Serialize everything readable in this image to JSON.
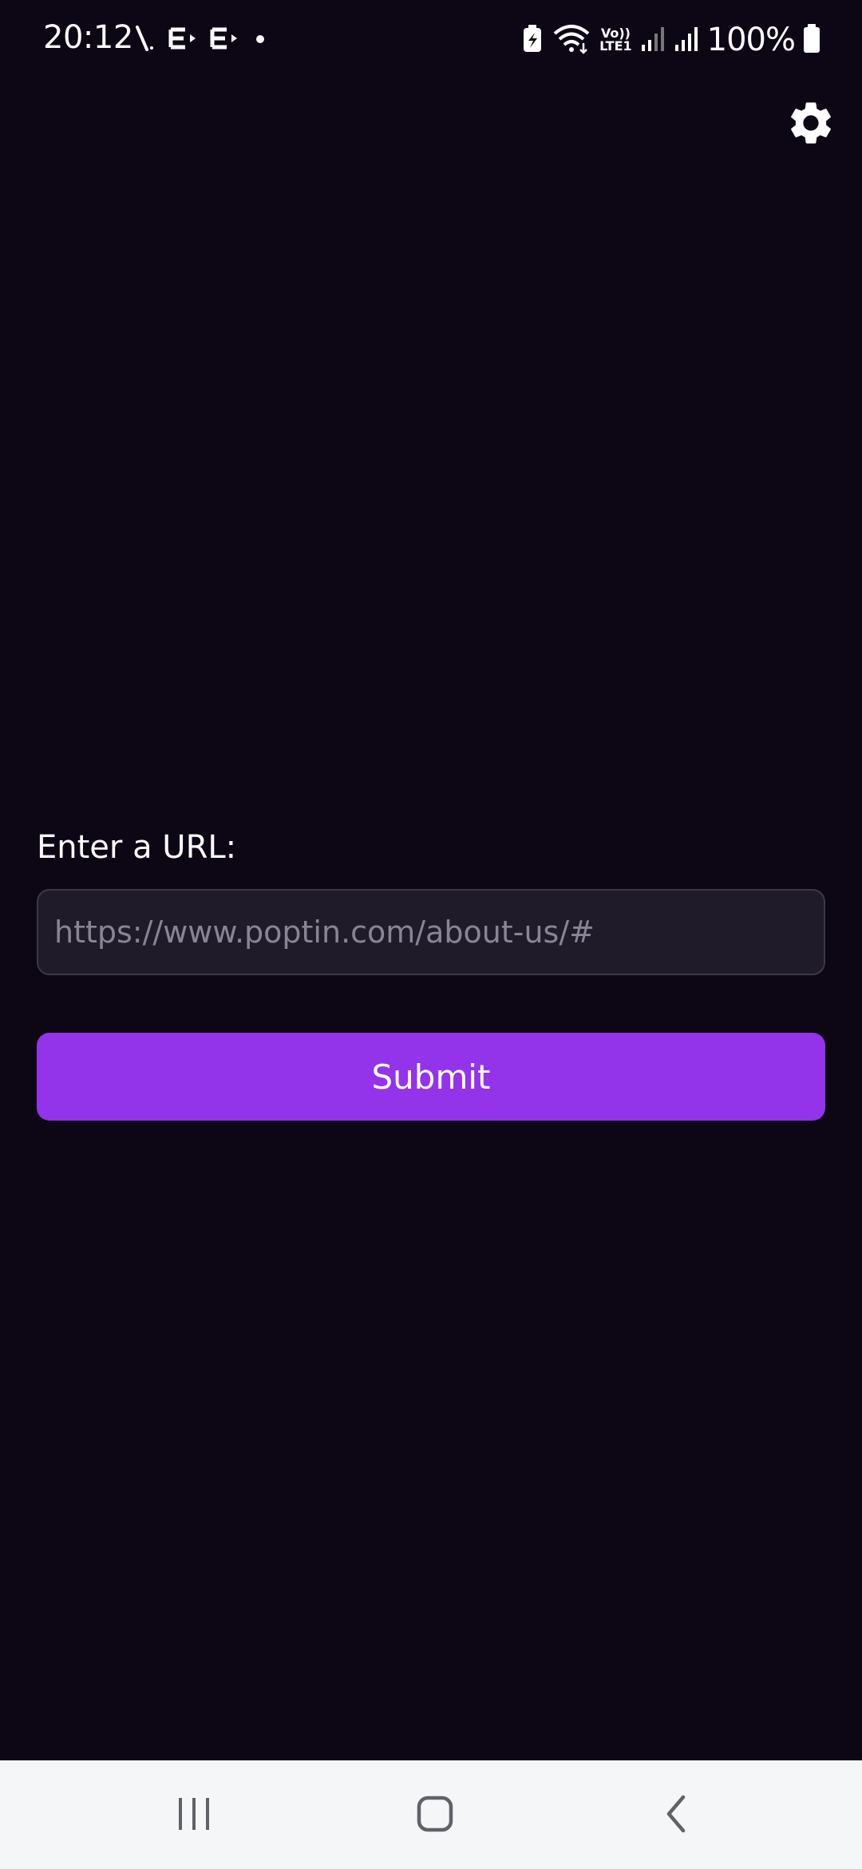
{
  "status_bar": {
    "time": "20:12",
    "battery_percent": "100%",
    "network_label_top": "Vo))",
    "network_label_bottom": "LTE1",
    "icons": [
      "nfc-icon",
      "e-network-icon",
      "e-network-icon",
      "dot-icon",
      "battery-saver-icon",
      "wifi-icon",
      "signal-icon",
      "signal-icon",
      "battery-icon"
    ]
  },
  "header": {
    "settings_icon": "gear-icon"
  },
  "form": {
    "label": "Enter a URL:",
    "url_value": "",
    "url_placeholder": "https://www.poptin.com/about-us/#",
    "submit_label": "Submit"
  },
  "nav_bar": {
    "icons": [
      "recent-apps-icon",
      "home-icon",
      "back-icon"
    ]
  },
  "colors": {
    "background": "#0c0615",
    "accent": "#9333ea",
    "input_background": "#201b29",
    "nav_background": "#f5f6f8"
  }
}
